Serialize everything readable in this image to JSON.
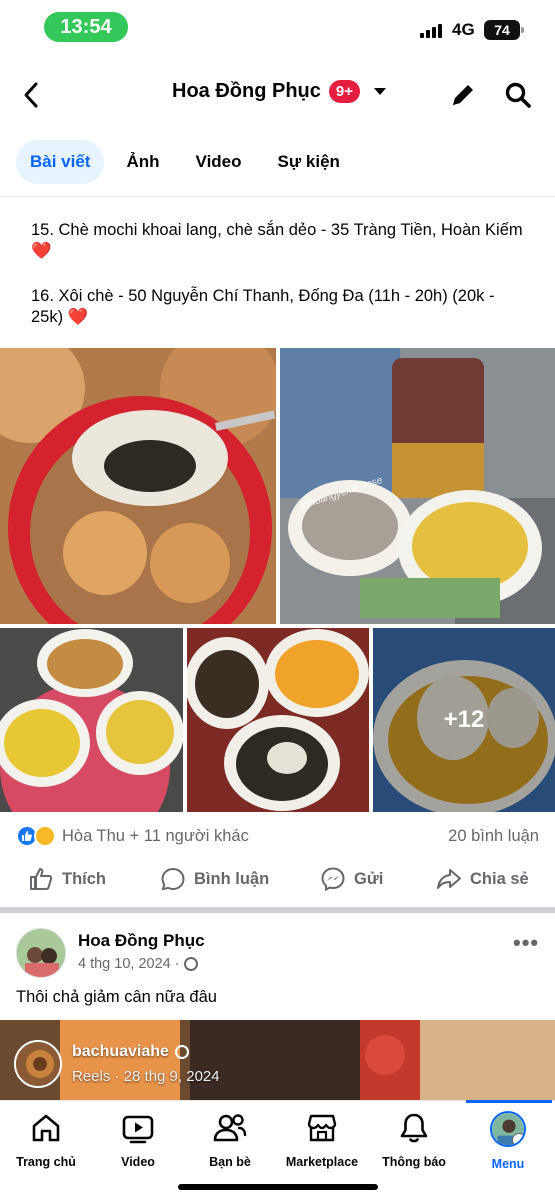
{
  "status_bar": {
    "time": "13:54",
    "network": "4G",
    "battery": "74"
  },
  "header": {
    "title": "Hoa Đồng Phục",
    "badge": "9+"
  },
  "tabs": [
    {
      "label": "Bài viết",
      "active": true
    },
    {
      "label": "Ảnh",
      "active": false
    },
    {
      "label": "Video",
      "active": false
    },
    {
      "label": "Sự kiện",
      "active": false
    }
  ],
  "post": {
    "lines": [
      "15.  Chè mochi khoai lang, chè sắn dẻo - 35 Tràng Tiền, Hoàn Kiếm ",
      "16. Xôi chè  - 50 Nguyễn Chí Thanh, Đống Đa (11h - 20h) (20k - 25k) "
    ],
    "heart": "❤️",
    "photo_watermark": "@hoangyenlit_rose",
    "more_photos": "+12",
    "reactions_text": "Hòa Thu + 11 người khác",
    "comments_text": "20 bình luận",
    "actions": {
      "like": "Thích",
      "comment": "Bình luận",
      "send": "Gửi",
      "share": "Chia sẻ"
    }
  },
  "post2": {
    "author": "Hoa Đồng Phục",
    "date": "4 thg 10, 2024 ·",
    "text": "Thôi chả giảm cân nữa đâu",
    "reel_author": "bachuaviahe",
    "reel_meta": "Reels · 28 thg 9, 2024"
  },
  "bottom_nav": [
    {
      "label": "Trang chủ",
      "icon": "home-icon"
    },
    {
      "label": "Video",
      "icon": "video-icon"
    },
    {
      "label": "Bạn bè",
      "icon": "friends-icon"
    },
    {
      "label": "Marketplace",
      "icon": "marketplace-icon"
    },
    {
      "label": "Thông báo",
      "icon": "bell-icon"
    },
    {
      "label": "Menu",
      "icon": "menu-avatar",
      "active": true
    }
  ],
  "colors": {
    "accent": "#0866ff",
    "badge": "#e41e3f",
    "secondary_text": "#65676b"
  }
}
